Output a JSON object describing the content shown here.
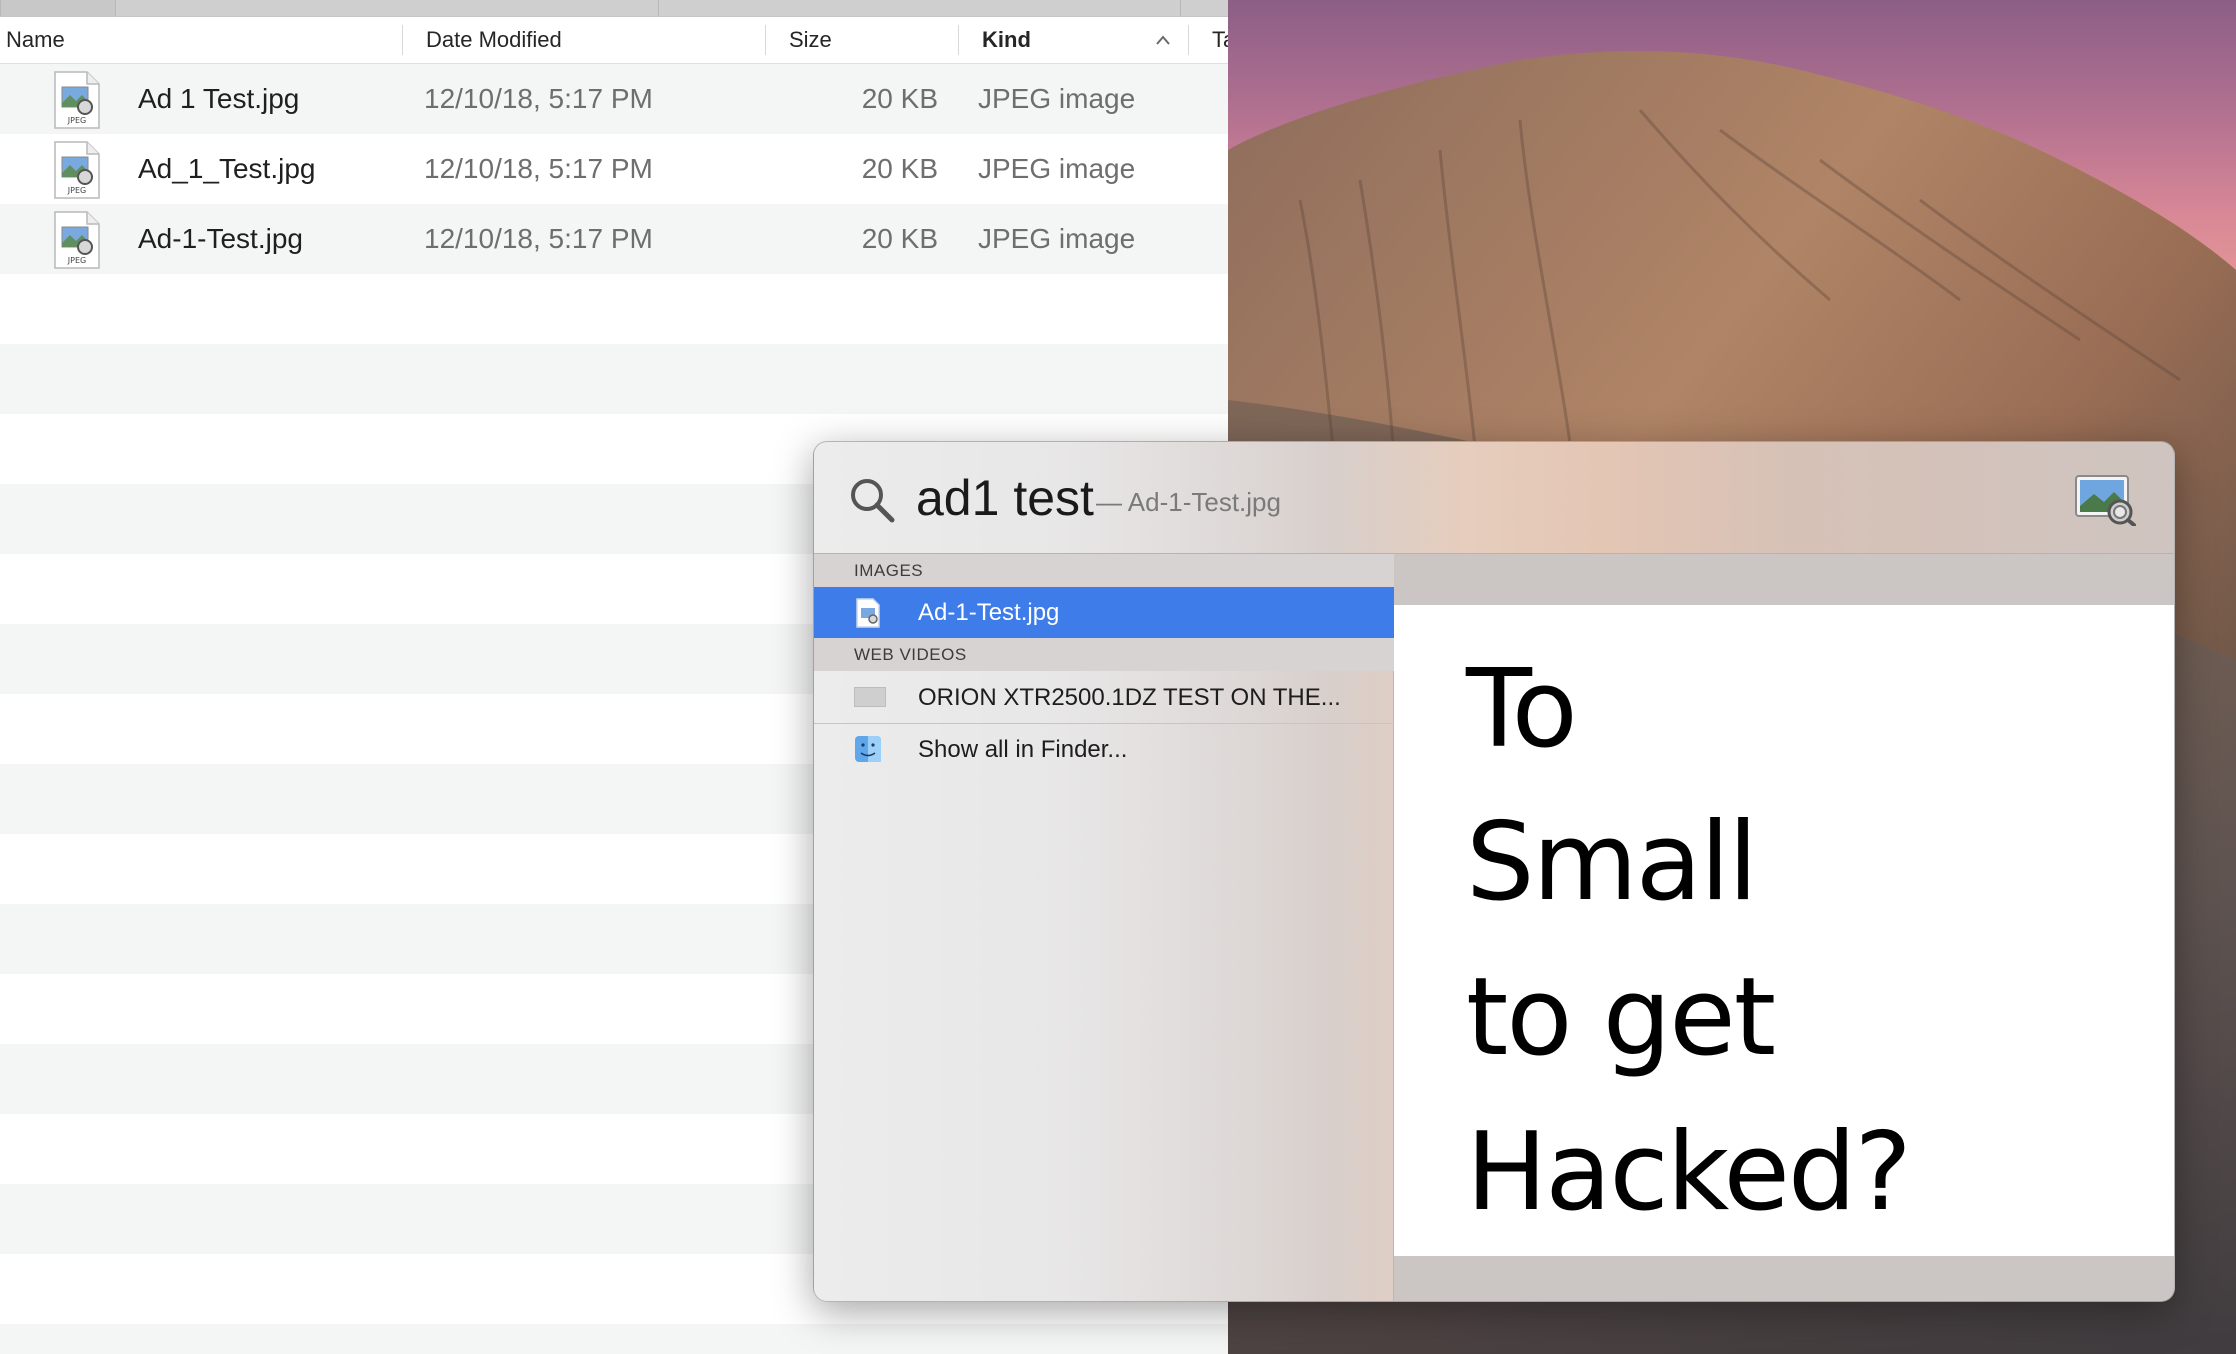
{
  "finder": {
    "columns": {
      "name": "Name",
      "date_modified": "Date Modified",
      "size": "Size",
      "kind": "Kind",
      "tags": "Ta"
    },
    "files": [
      {
        "name": "Ad 1 Test.jpg",
        "date": "12/10/18, 5:17 PM",
        "size": "20 KB",
        "kind": "JPEG image",
        "icon": "jpeg-file-icon"
      },
      {
        "name": "Ad_1_Test.jpg",
        "date": "12/10/18, 5:17 PM",
        "size": "20 KB",
        "kind": "JPEG image",
        "icon": "jpeg-file-icon"
      },
      {
        "name": "Ad-1-Test.jpg",
        "date": "12/10/18, 5:17 PM",
        "size": "20 KB",
        "kind": "JPEG image",
        "icon": "jpeg-file-icon"
      }
    ],
    "file_icon_caption": "JPEG"
  },
  "spotlight": {
    "query": "ad1 test",
    "completion": "— Ad-1-Test.jpg",
    "sections": [
      {
        "label": "IMAGES",
        "items": [
          {
            "label": "Ad-1-Test.jpg",
            "selected": true,
            "icon": "jpeg-file-icon"
          }
        ]
      },
      {
        "label": "WEB VIDEOS",
        "items": [
          {
            "label": "ORION XTR2500.1DZ TEST ON THE...",
            "selected": false,
            "icon": "video-thumbnail-icon"
          }
        ]
      }
    ],
    "show_all": "Show all in Finder...",
    "preview_lines": [
      "To",
      "Small",
      "to get",
      "Hacked?"
    ]
  },
  "colors": {
    "selection": "#3d7ce9",
    "sky_top": "#8c5e86",
    "sky_glow": "#e8a098"
  }
}
